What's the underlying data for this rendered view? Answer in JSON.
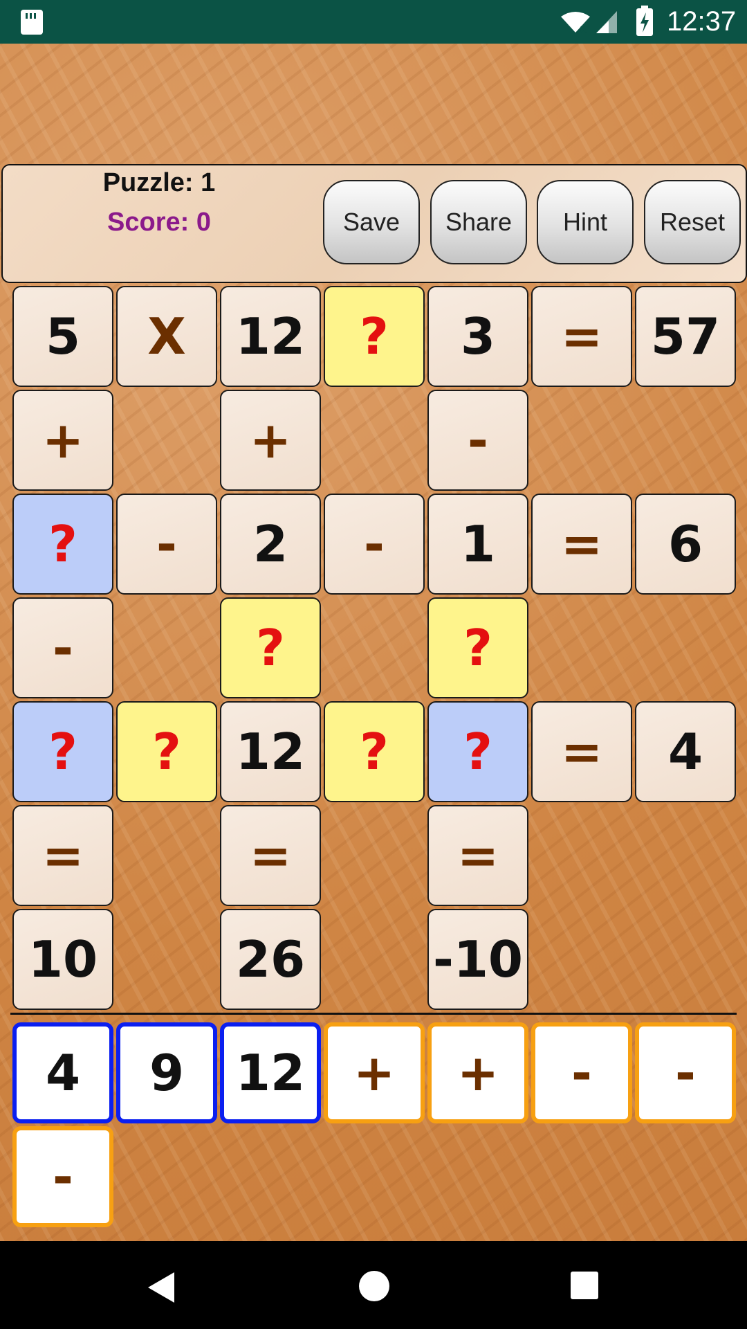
{
  "status_bar": {
    "time": "12:37"
  },
  "header": {
    "puzzle": "Puzzle: 1",
    "score": "Score: 0",
    "buttons": {
      "save": "Save",
      "share": "Share",
      "hint": "Hint",
      "reset": "Reset"
    }
  },
  "grid": [
    [
      "5",
      "X",
      "12",
      "?",
      "3",
      "=",
      "57"
    ],
    [
      "+",
      "",
      "+",
      "",
      "-",
      "",
      ""
    ],
    [
      "?",
      "-",
      "2",
      "-",
      "1",
      "=",
      "6"
    ],
    [
      "-",
      "",
      "?",
      "",
      "?",
      "",
      ""
    ],
    [
      "?",
      "?",
      "12",
      "?",
      "?",
      "=",
      "4"
    ],
    [
      "=",
      "",
      "=",
      "",
      "=",
      "",
      ""
    ],
    [
      "10",
      "",
      "26",
      "",
      "-10",
      "",
      ""
    ]
  ],
  "pieces": [
    "4",
    "9",
    "12",
    "+",
    "+",
    "-",
    "-",
    "-"
  ],
  "colors": {
    "status_bar": "#0b5345",
    "tile": "#f4e5d7",
    "empty_slot_yellow": "#fef48c",
    "empty_slot_blue": "#bccdf9",
    "question_mark": "#e41010",
    "operator": "#6b2f00",
    "number_piece_border": "#0b1ff0",
    "operator_piece_border": "#f7a012",
    "score": "#8b1a8b"
  },
  "icons": [
    "sd-card-icon",
    "wifi-icon",
    "signal-icon",
    "battery-icon",
    "back-icon",
    "home-icon",
    "recents-icon"
  ]
}
